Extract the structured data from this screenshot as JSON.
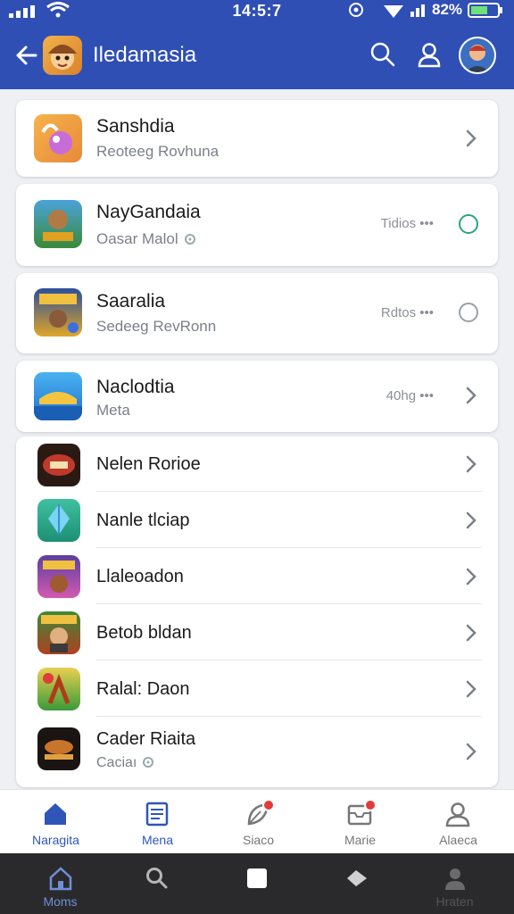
{
  "status_bar": {
    "time": "14:5:7",
    "battery": "82%"
  },
  "app_bar": {
    "title": "Iledamasia"
  },
  "items": [
    {
      "name": "Sanshdia",
      "subtitle": "Reoteeg Rovhuna",
      "meta": "",
      "trailing": "chevron"
    },
    {
      "name": "NayGandaia",
      "subtitle": "Oasar Malol",
      "meta": "Tidios •••",
      "trailing": "ring-teal"
    },
    {
      "name": "Saaralia",
      "subtitle": "Sedeeg RevRonn",
      "meta": "Rdtos •••",
      "trailing": "ring-gray"
    },
    {
      "name": "Naclodtia",
      "subtitle": "Meta",
      "meta": "40hg •••",
      "trailing": "chevron"
    }
  ],
  "group_items": [
    {
      "name": "Nelen Rorioe",
      "subtitle": ""
    },
    {
      "name": "Nanle tlciap",
      "subtitle": ""
    },
    {
      "name": "Llaleoadon",
      "subtitle": ""
    },
    {
      "name": "Betob bldan",
      "subtitle": ""
    },
    {
      "name": "Ralal: Daon",
      "subtitle": ""
    },
    {
      "name": "Cader Riaita",
      "subtitle": "Caciaı"
    }
  ],
  "tabbar": [
    {
      "label": "Naragita",
      "icon": "home-icon",
      "active": true
    },
    {
      "label": "Mena",
      "icon": "news-icon",
      "active": true
    },
    {
      "label": "Siaco",
      "icon": "leaf-icon",
      "active": false
    },
    {
      "label": "Marie",
      "icon": "inbox-icon",
      "active": false
    },
    {
      "label": "Alaeca",
      "icon": "profile-icon",
      "active": false
    }
  ],
  "system_nav": [
    {
      "label": "Moms",
      "icon": "home-icon"
    },
    {
      "label": "",
      "icon": "search-icon"
    },
    {
      "label": "",
      "icon": "square-icon"
    },
    {
      "label": "",
      "icon": "tag-icon"
    },
    {
      "label": "Hraten",
      "icon": "person-icon"
    }
  ],
  "colors": {
    "header": "#2f4fb5",
    "accent": "#2f55b8",
    "teal": "#2aa57a",
    "badge": "#e23b3b"
  }
}
